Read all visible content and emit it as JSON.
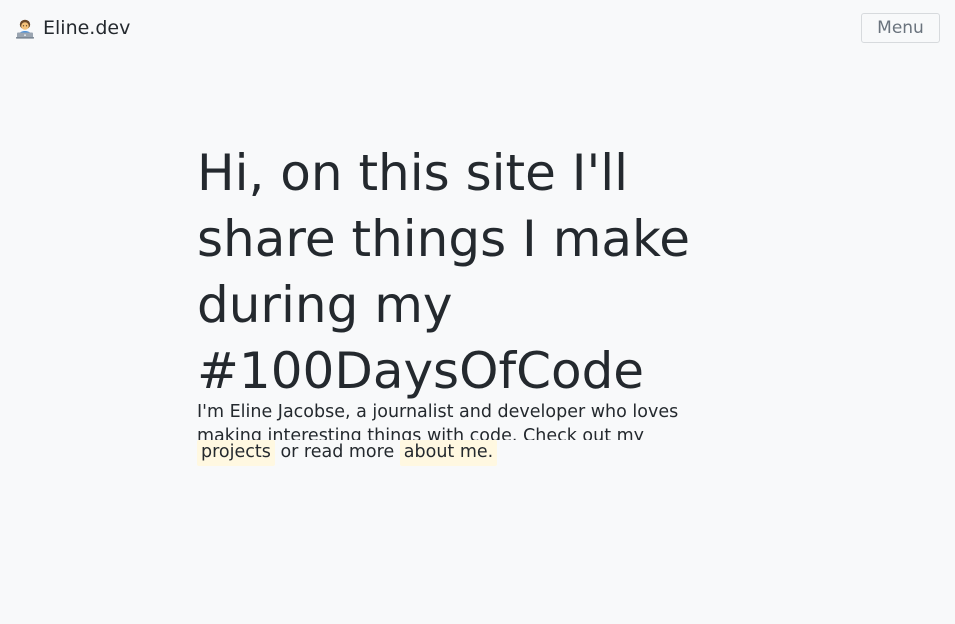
{
  "header": {
    "brand_name": "Eline.dev",
    "brand_icon": "technologist-emoji-icon",
    "menu_label": "Menu"
  },
  "hero": {
    "title": "Hi, on this site I'll share things I make during my #100DaysOfCode"
  },
  "intro": {
    "line1": "I'm Eline Jacobse, a journalist and developer who loves",
    "line2": "making interesting things with code. Check out my",
    "projects_link": "projects",
    "middle_text": "or read more",
    "about_link": "about me."
  }
}
